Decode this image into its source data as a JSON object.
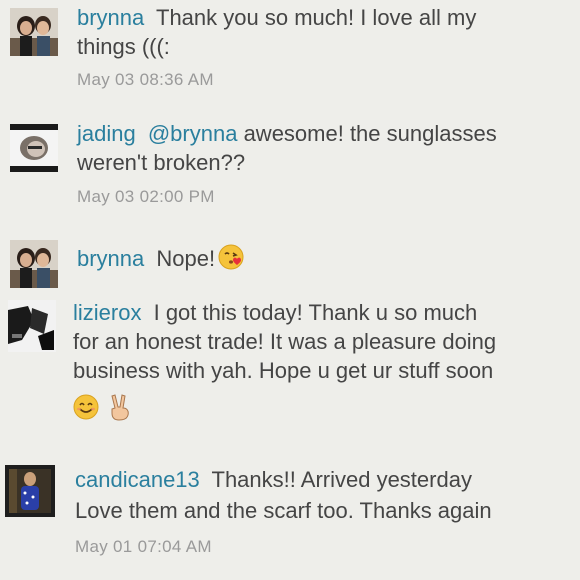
{
  "comments": [
    {
      "username": "brynna",
      "text": "Thank you so much! I love all my things (((:",
      "timestamp": "May 03 08:36 AM"
    },
    {
      "username": "jading",
      "mention": "@brynna",
      "text": " awesome! the sunglasses weren't broken??",
      "timestamp": "May 03 02:00 PM"
    },
    {
      "username": "brynna",
      "text": "Nope!",
      "emoji": "kissing-face-emoji"
    },
    {
      "username": "lizierox",
      "line1": "I got this today! Thank u so much",
      "line2": "for an honest trade! It was a pleasure doing",
      "line3": "business with yah. Hope u get ur stuff soon",
      "emojis": [
        "smiling-face-emoji",
        "victory-hand-emoji"
      ]
    },
    {
      "username": "candicane13",
      "line1": "Thanks!! Arrived yesterday",
      "line2": "Love them and the scarf too. Thanks again",
      "timestamp": "May 01 07:04 AM"
    }
  ]
}
